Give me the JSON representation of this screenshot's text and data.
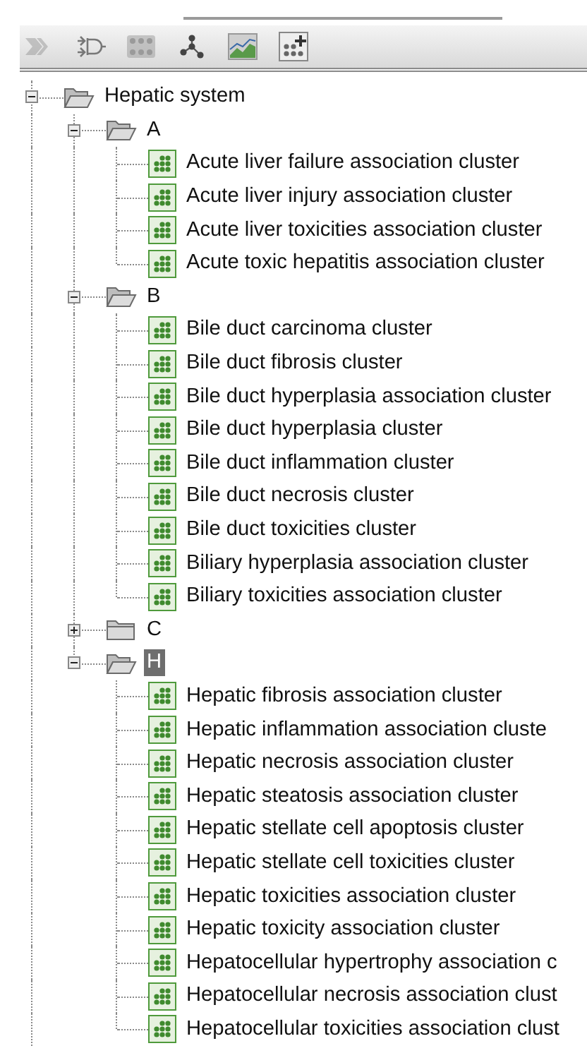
{
  "toolbar": {
    "buttons": [
      {
        "kind": "run",
        "disabled": true
      },
      {
        "kind": "filter",
        "disabled": false
      },
      {
        "kind": "network",
        "disabled": false
      },
      {
        "kind": "graph",
        "disabled": false
      },
      {
        "kind": "chart",
        "disabled": false
      },
      {
        "kind": "add-cluster",
        "disabled": false
      }
    ]
  },
  "tree": [
    {
      "label": "Hepatic system",
      "kind": "folder",
      "expanded": true,
      "selected": false,
      "children": [
        {
          "label": "A",
          "kind": "folder",
          "expanded": true,
          "selected": false,
          "children": [
            {
              "label": "Acute liver failure association cluster",
              "kind": "cluster"
            },
            {
              "label": "Acute liver injury association cluster",
              "kind": "cluster"
            },
            {
              "label": "Acute liver toxicities association cluster",
              "kind": "cluster"
            },
            {
              "label": "Acute toxic hepatitis association cluster",
              "kind": "cluster"
            }
          ]
        },
        {
          "label": "B",
          "kind": "folder",
          "expanded": true,
          "selected": false,
          "children": [
            {
              "label": "Bile duct carcinoma cluster",
              "kind": "cluster"
            },
            {
              "label": "Bile duct fibrosis cluster",
              "kind": "cluster"
            },
            {
              "label": "Bile duct hyperplasia association cluster",
              "kind": "cluster"
            },
            {
              "label": "Bile duct hyperplasia cluster",
              "kind": "cluster"
            },
            {
              "label": "Bile duct inflammation cluster",
              "kind": "cluster"
            },
            {
              "label": "Bile duct necrosis cluster",
              "kind": "cluster"
            },
            {
              "label": "Bile duct toxicities cluster",
              "kind": "cluster"
            },
            {
              "label": "Biliary hyperplasia association cluster",
              "kind": "cluster"
            },
            {
              "label": "Biliary toxicities association cluster",
              "kind": "cluster"
            }
          ]
        },
        {
          "label": "C",
          "kind": "folder",
          "expanded": false,
          "selected": false
        },
        {
          "label": "H",
          "kind": "folder",
          "expanded": true,
          "selected": true,
          "children": [
            {
              "label": "Hepatic fibrosis association cluster",
              "kind": "cluster"
            },
            {
              "label": "Hepatic inflammation association cluste",
              "kind": "cluster"
            },
            {
              "label": "Hepatic necrosis association cluster",
              "kind": "cluster"
            },
            {
              "label": "Hepatic steatosis association cluster",
              "kind": "cluster"
            },
            {
              "label": "Hepatic stellate cell apoptosis cluster",
              "kind": "cluster"
            },
            {
              "label": "Hepatic stellate cell toxicities cluster",
              "kind": "cluster"
            },
            {
              "label": "Hepatic toxicities association cluster",
              "kind": "cluster"
            },
            {
              "label": "Hepatic toxicity association cluster",
              "kind": "cluster"
            },
            {
              "label": "Hepatocellular hypertrophy association c",
              "kind": "cluster"
            },
            {
              "label": "Hepatocellular necrosis association clust",
              "kind": "cluster"
            },
            {
              "label": "Hepatocellular toxicities association clust",
              "kind": "cluster"
            }
          ]
        }
      ]
    }
  ]
}
